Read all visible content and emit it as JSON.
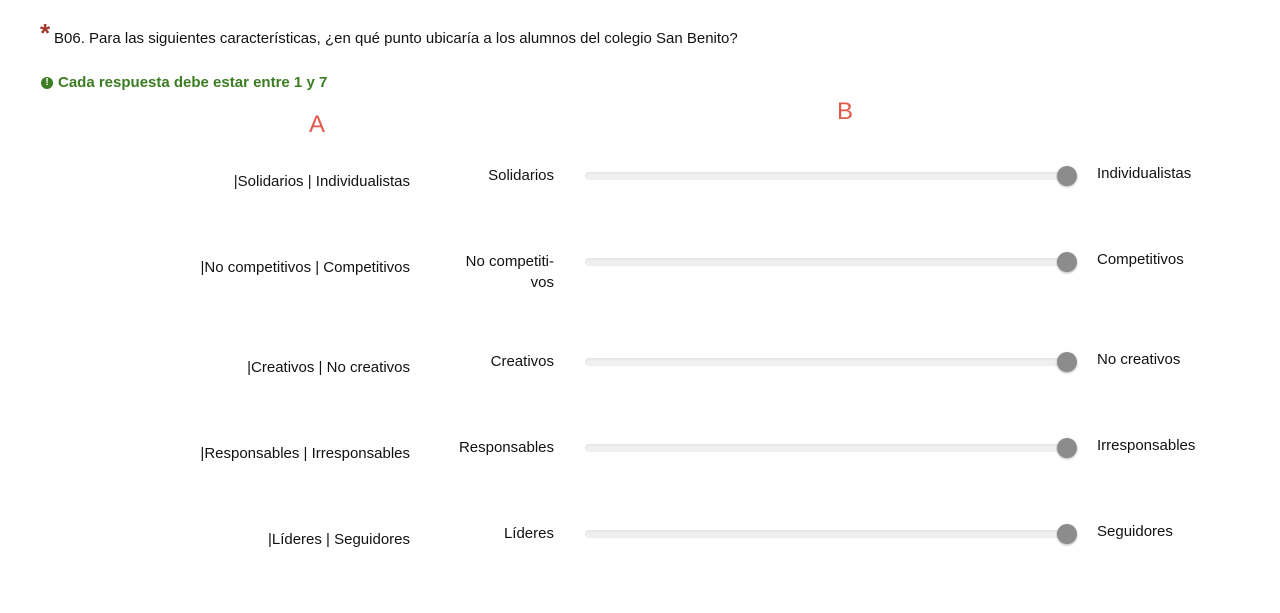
{
  "question": {
    "asterisk": "*",
    "text": "B06. Para las siguientes características, ¿en qué punto ubicaría a los alumnos del colegio San Benito?"
  },
  "validation": {
    "icon": "exclamation-circle-icon",
    "text": "Cada respuesta debe estar entre 1 y 7"
  },
  "annotations": {
    "a": "A",
    "b": "B"
  },
  "colors": {
    "validation": "#3b7d22",
    "asterisk": "#a33a2f",
    "annotation": "#e05a4a",
    "handle": "#8c8c8c"
  },
  "sliders": [
    {
      "label": "|Solidarios | Individualistas",
      "left": "Solidarios",
      "right": "Individualistas",
      "position": 1.0
    },
    {
      "label": "|No competitivos | Competitivos",
      "left": "No competiti-\nvos",
      "right": "Competitivos",
      "position": 1.0
    },
    {
      "label": "|Creativos | No creativos",
      "left": "Creativos",
      "right": "No creativos",
      "position": 1.0
    },
    {
      "label": "|Responsables | Irresponsables",
      "left": "Responsables",
      "right": "Irresponsables",
      "position": 1.0
    },
    {
      "label": "|Líderes | Seguidores",
      "left": "Líderes",
      "right": "Seguidores",
      "position": 1.0
    }
  ]
}
